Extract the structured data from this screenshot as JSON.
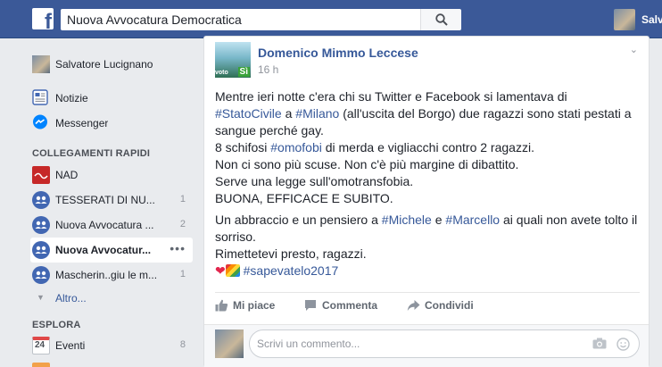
{
  "topbar": {
    "search_value": "Nuova Avvocatura Democratica",
    "user_name": "Salvatore"
  },
  "leftnav": {
    "profile_name": "Salvatore Lucignano",
    "items": [
      {
        "label": "Notizie"
      },
      {
        "label": "Messenger"
      }
    ],
    "shortcuts_heading": "COLLEGAMENTI RAPIDI",
    "shortcuts": [
      {
        "label": "NAD",
        "count": ""
      },
      {
        "label": "TESSERATI DI NU...",
        "count": "1"
      },
      {
        "label": "Nuova Avvocatura ...",
        "count": "2"
      },
      {
        "label": "Nuova Avvocatur...",
        "count": ""
      },
      {
        "label": "Mascherin..giu le m...",
        "count": "1"
      }
    ],
    "more_label": "Altro...",
    "explore_heading": "ESPLORA",
    "explore": [
      {
        "label": "Eventi",
        "count": "8",
        "icon_text": "24"
      }
    ]
  },
  "post": {
    "author": "Domenico Mimmo Leccese",
    "time": "16 h",
    "avatar_text_a": "voto",
    "avatar_text_b": "Sì",
    "p1_a": "Mentre ieri notte c'era chi su Twitter e Facebook si lamentava di",
    "p1_tag1": "#StatoCivile",
    "p1_b": " a ",
    "p1_tag2": "#Milano",
    "p1_c": " (all'uscita del Borgo) due ragazzi sono stati pestati a sangue perché gay.",
    "p1_d1": "8 schifosi ",
    "p1_tag3": "#omofobi",
    "p1_d2": " di merda e vigliacchi contro 2 ragazzi.",
    "p1_e": "Non ci sono più scuse. Non c'è più margine di dibattito.",
    "p1_f": "Serve una legge sull'omotransfobia.",
    "p1_g": "BUONA, EFFICACE E SUBITO.",
    "p2_a": "Un abbraccio e un pensiero a ",
    "p2_tag1": "#Michele",
    "p2_b": " e ",
    "p2_tag2": "#Marcello",
    "p2_c": " ai quali non avete tolto il sorriso.",
    "p2_d": "Rimettetevi presto, ragazzi.",
    "p2_tag3": "#sapevatelo2017"
  },
  "actions": {
    "like": "Mi piace",
    "comment": "Commenta",
    "share": "Condividi"
  },
  "comment": {
    "placeholder": "Scrivi un commento..."
  },
  "colors": {
    "brand": "#3b5998",
    "link": "#365899",
    "background": "#e9ebee"
  }
}
